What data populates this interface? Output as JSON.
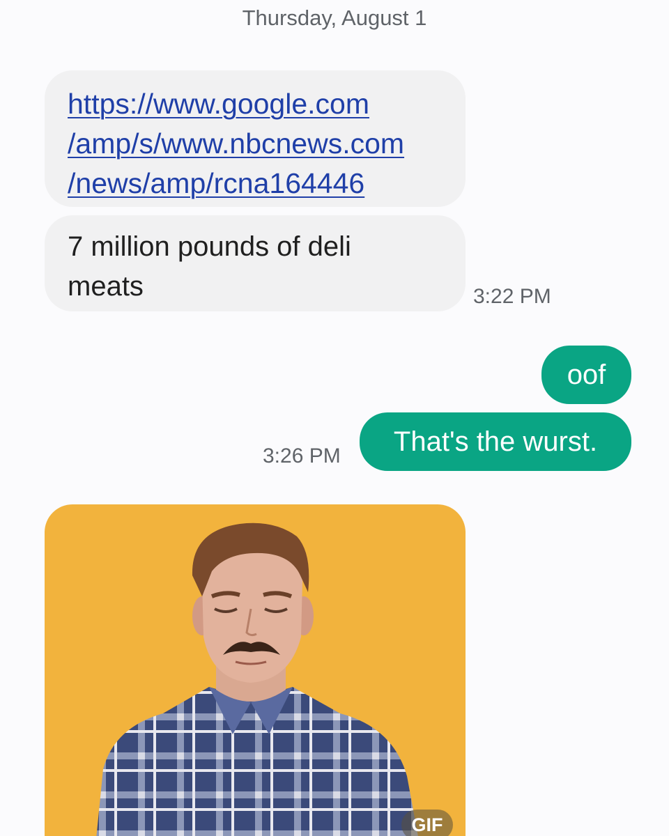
{
  "date_divider": "Thursday, August 1",
  "messages": {
    "link": {
      "lines": [
        "https://www.google.com",
        "/amp/s/www.nbcnews.com",
        "/news/amp/rcna164446"
      ]
    },
    "deli": {
      "lines": [
        "7 million pounds of deli",
        "meats"
      ]
    },
    "incoming_time": "3:22 PM",
    "oof": "oof",
    "wurst": "That's the wurst.",
    "outgoing_time": "3:26 PM",
    "gif": {
      "badge": "GIF"
    }
  },
  "colors": {
    "incoming_bubble": "#f1f1f2",
    "outgoing_bubble": "#0aa584",
    "link": "#1f3fa8",
    "gif_background": "#f2b33d"
  }
}
